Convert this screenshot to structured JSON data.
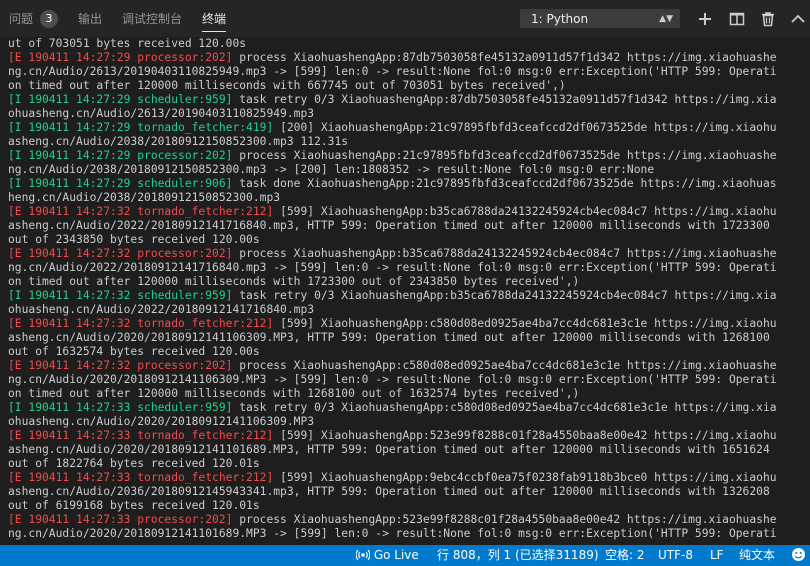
{
  "panel": {
    "tabs": [
      {
        "label": "问题",
        "badge": "3"
      },
      {
        "label": "输出"
      },
      {
        "label": "调试控制台"
      },
      {
        "label": "终端"
      }
    ],
    "terminal_select": "1: Python",
    "icons": [
      "plus-icon",
      "split-icon",
      "trash-icon",
      "chevron-up-icon"
    ]
  },
  "terminal": {
    "lines": [
      {
        "tag": "",
        "rest": "ut of 703051 bytes received 120.00s"
      },
      {
        "tag": "[E 190411 14:27:29 processor:202]",
        "rest": " process XiaohuashengApp:87db7503058fe45132a0911d57f1d342 https://img.xiaohuashe"
      },
      {
        "tag": "",
        "rest": "ng.cn/Audio/2613/20190403110825949.mp3 -> [599] len:0 -> result:None fol:0 msg:0 err:Exception('HTTP 599: Operati"
      },
      {
        "tag": "",
        "rest": "on timed out after 120000 milliseconds with 667745 out of 703051 bytes received',)"
      },
      {
        "tag": "[I 190411 14:27:29 scheduler:959]",
        "rest": " task retry 0/3 XiaohuashengApp:87db7503058fe45132a0911d57f1d342 https://img.xia"
      },
      {
        "tag": "",
        "rest": "ohuasheng.cn/Audio/2613/20190403110825949.mp3"
      },
      {
        "tag": "[I 190411 14:27:29 tornado_fetcher:419]",
        "rest": " [200] XiaohuashengApp:21c97895fbfd3ceafccd2df0673525de https://img.xiaohu"
      },
      {
        "tag": "",
        "rest": "asheng.cn/Audio/2038/20180912150852300.mp3 112.31s"
      },
      {
        "tag": "[I 190411 14:27:29 processor:202]",
        "rest": " process XiaohuashengApp:21c97895fbfd3ceafccd2df0673525de https://img.xiaohuashe"
      },
      {
        "tag": "",
        "rest": "ng.cn/Audio/2038/20180912150852300.mp3 -> [200] len:1808352 -> result:None fol:0 msg:0 err:None"
      },
      {
        "tag": "[I 190411 14:27:29 scheduler:906]",
        "rest": " task done XiaohuashengApp:21c97895fbfd3ceafccd2df0673525de https://img.xiaohuas"
      },
      {
        "tag": "",
        "rest": "heng.cn/Audio/2038/20180912150852300.mp3"
      },
      {
        "tag": "[E 190411 14:27:32 tornado_fetcher:212]",
        "rest": " [599] XiaohuashengApp:b35ca6788da24132245924cb4ec084c7 https://img.xiaohu"
      },
      {
        "tag": "",
        "rest": "asheng.cn/Audio/2022/20180912141716840.mp3, HTTP 599: Operation timed out after 120000 milliseconds with 1723300"
      },
      {
        "tag": "",
        "rest": "out of 2343850 bytes received 120.00s"
      },
      {
        "tag": "[E 190411 14:27:32 processor:202]",
        "rest": " process XiaohuashengApp:b35ca6788da24132245924cb4ec084c7 https://img.xiaohuashe"
      },
      {
        "tag": "",
        "rest": "ng.cn/Audio/2022/20180912141716840.mp3 -> [599] len:0 -> result:None fol:0 msg:0 err:Exception('HTTP 599: Operati"
      },
      {
        "tag": "",
        "rest": "on timed out after 120000 milliseconds with 1723300 out of 2343850 bytes received',)"
      },
      {
        "tag": "[I 190411 14:27:32 scheduler:959]",
        "rest": " task retry 0/3 XiaohuashengApp:b35ca6788da24132245924cb4ec084c7 https://img.xia"
      },
      {
        "tag": "",
        "rest": "ohuasheng.cn/Audio/2022/20180912141716840.mp3"
      },
      {
        "tag": "[E 190411 14:27:32 tornado_fetcher:212]",
        "rest": " [599] XiaohuashengApp:c580d08ed0925ae4ba7cc4dc681e3c1e https://img.xiaohu"
      },
      {
        "tag": "",
        "rest": "asheng.cn/Audio/2020/20180912141106309.MP3, HTTP 599: Operation timed out after 120000 milliseconds with 1268100"
      },
      {
        "tag": "",
        "rest": "out of 1632574 bytes received 120.00s"
      },
      {
        "tag": "[E 190411 14:27:32 processor:202]",
        "rest": " process XiaohuashengApp:c580d08ed0925ae4ba7cc4dc681e3c1e https://img.xiaohuashe"
      },
      {
        "tag": "",
        "rest": "ng.cn/Audio/2020/20180912141106309.MP3 -> [599] len:0 -> result:None fol:0 msg:0 err:Exception('HTTP 599: Operati"
      },
      {
        "tag": "",
        "rest": "on timed out after 120000 milliseconds with 1268100 out of 1632574 bytes received',)"
      },
      {
        "tag": "[I 190411 14:27:33 scheduler:959]",
        "rest": " task retry 0/3 XiaohuashengApp:c580d08ed0925ae4ba7cc4dc681e3c1e https://img.xia"
      },
      {
        "tag": "",
        "rest": "ohuasheng.cn/Audio/2020/20180912141106309.MP3"
      },
      {
        "tag": "[E 190411 14:27:33 tornado_fetcher:212]",
        "rest": " [599] XiaohuashengApp:523e99f8288c01f28a4550baa8e00e42 https://img.xiaohu"
      },
      {
        "tag": "",
        "rest": "asheng.cn/Audio/2020/20180912141101689.MP3, HTTP 599: Operation timed out after 120000 milliseconds with 1651624"
      },
      {
        "tag": "",
        "rest": "out of 1822764 bytes received 120.01s"
      },
      {
        "tag": "[E 190411 14:27:33 tornado_fetcher:212]",
        "rest": " [599] XiaohuashengApp:9ebc4ccbf0ea75f0238fab9118b3bce0 https://img.xiaohu"
      },
      {
        "tag": "",
        "rest": "asheng.cn/Audio/2036/20180912145943341.mp3, HTTP 599: Operation timed out after 120000 milliseconds with 1326208"
      },
      {
        "tag": "",
        "rest": "out of 6199168 bytes received 120.01s"
      },
      {
        "tag": "[E 190411 14:27:33 processor:202]",
        "rest": " process XiaohuashengApp:523e99f8288c01f28a4550baa8e00e42 https://img.xiaohuashe"
      },
      {
        "tag": "",
        "rest": "ng.cn/Audio/2020/20180912141101689.MP3 -> [599] len:0 -> result:None fol:0 msg:0 err:Exception('HTTP 599: Operati"
      }
    ]
  },
  "statusbar": {
    "live": "Go Live",
    "position": "行 808，列 1 (已选择31189)",
    "spaces": "空格: 2",
    "encoding": "UTF-8",
    "eol": "LF",
    "language": "纯文本",
    "icons": [
      "broadcast-icon",
      "smiley-icon"
    ]
  },
  "colors": {
    "error": "#f14c4c",
    "info": "#23d18b",
    "statusbar": "#007acc",
    "background": "#1e1e1e"
  }
}
